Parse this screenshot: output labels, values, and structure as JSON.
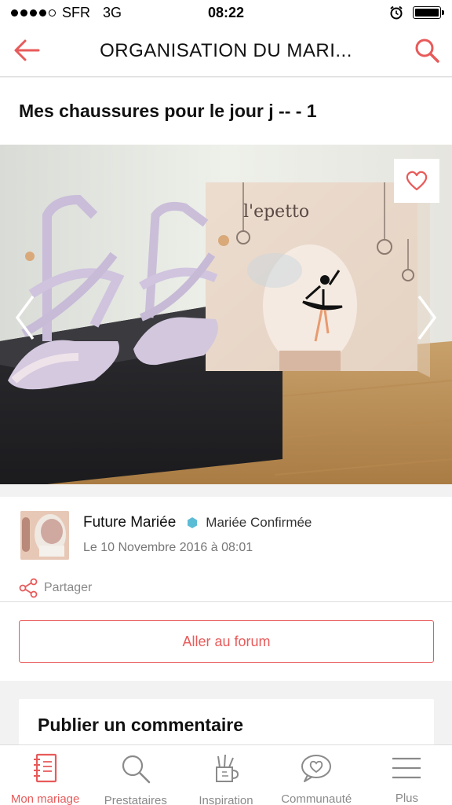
{
  "status": {
    "carrier": "SFR",
    "network": "3G",
    "time": "08:22",
    "signal_bars": 4,
    "signal_total": 5
  },
  "header": {
    "title": "ORGANISATION DU MARI...",
    "back_icon": "arrow-left-icon",
    "search_icon": "search-icon",
    "accent_color": "#e85a5a"
  },
  "topic": {
    "title": "Mes chaussures pour le jour j -- - 1"
  },
  "photo": {
    "box_logo": "repetto",
    "favorite_icon": "heart-icon"
  },
  "post": {
    "author": "Future Mariée",
    "badge": "Mariée Confirmée",
    "badge_color": "#5bbcd6",
    "date": "Le 10 Novembre 2016 à 08:01",
    "share_label": "Partager"
  },
  "forum_button": {
    "label": "Aller au forum"
  },
  "comment": {
    "title": "Publier un commentaire"
  },
  "tabs": [
    {
      "label": "Mon mariage",
      "icon": "notebook-icon",
      "active": true
    },
    {
      "label": "Prestataires",
      "icon": "search-icon",
      "active": false
    },
    {
      "label": "Inspiration",
      "icon": "pencil-cup-icon",
      "active": false
    },
    {
      "label": "Communauté",
      "icon": "heart-bubble-icon",
      "active": false
    },
    {
      "label": "Plus",
      "icon": "menu-icon",
      "active": false
    }
  ]
}
